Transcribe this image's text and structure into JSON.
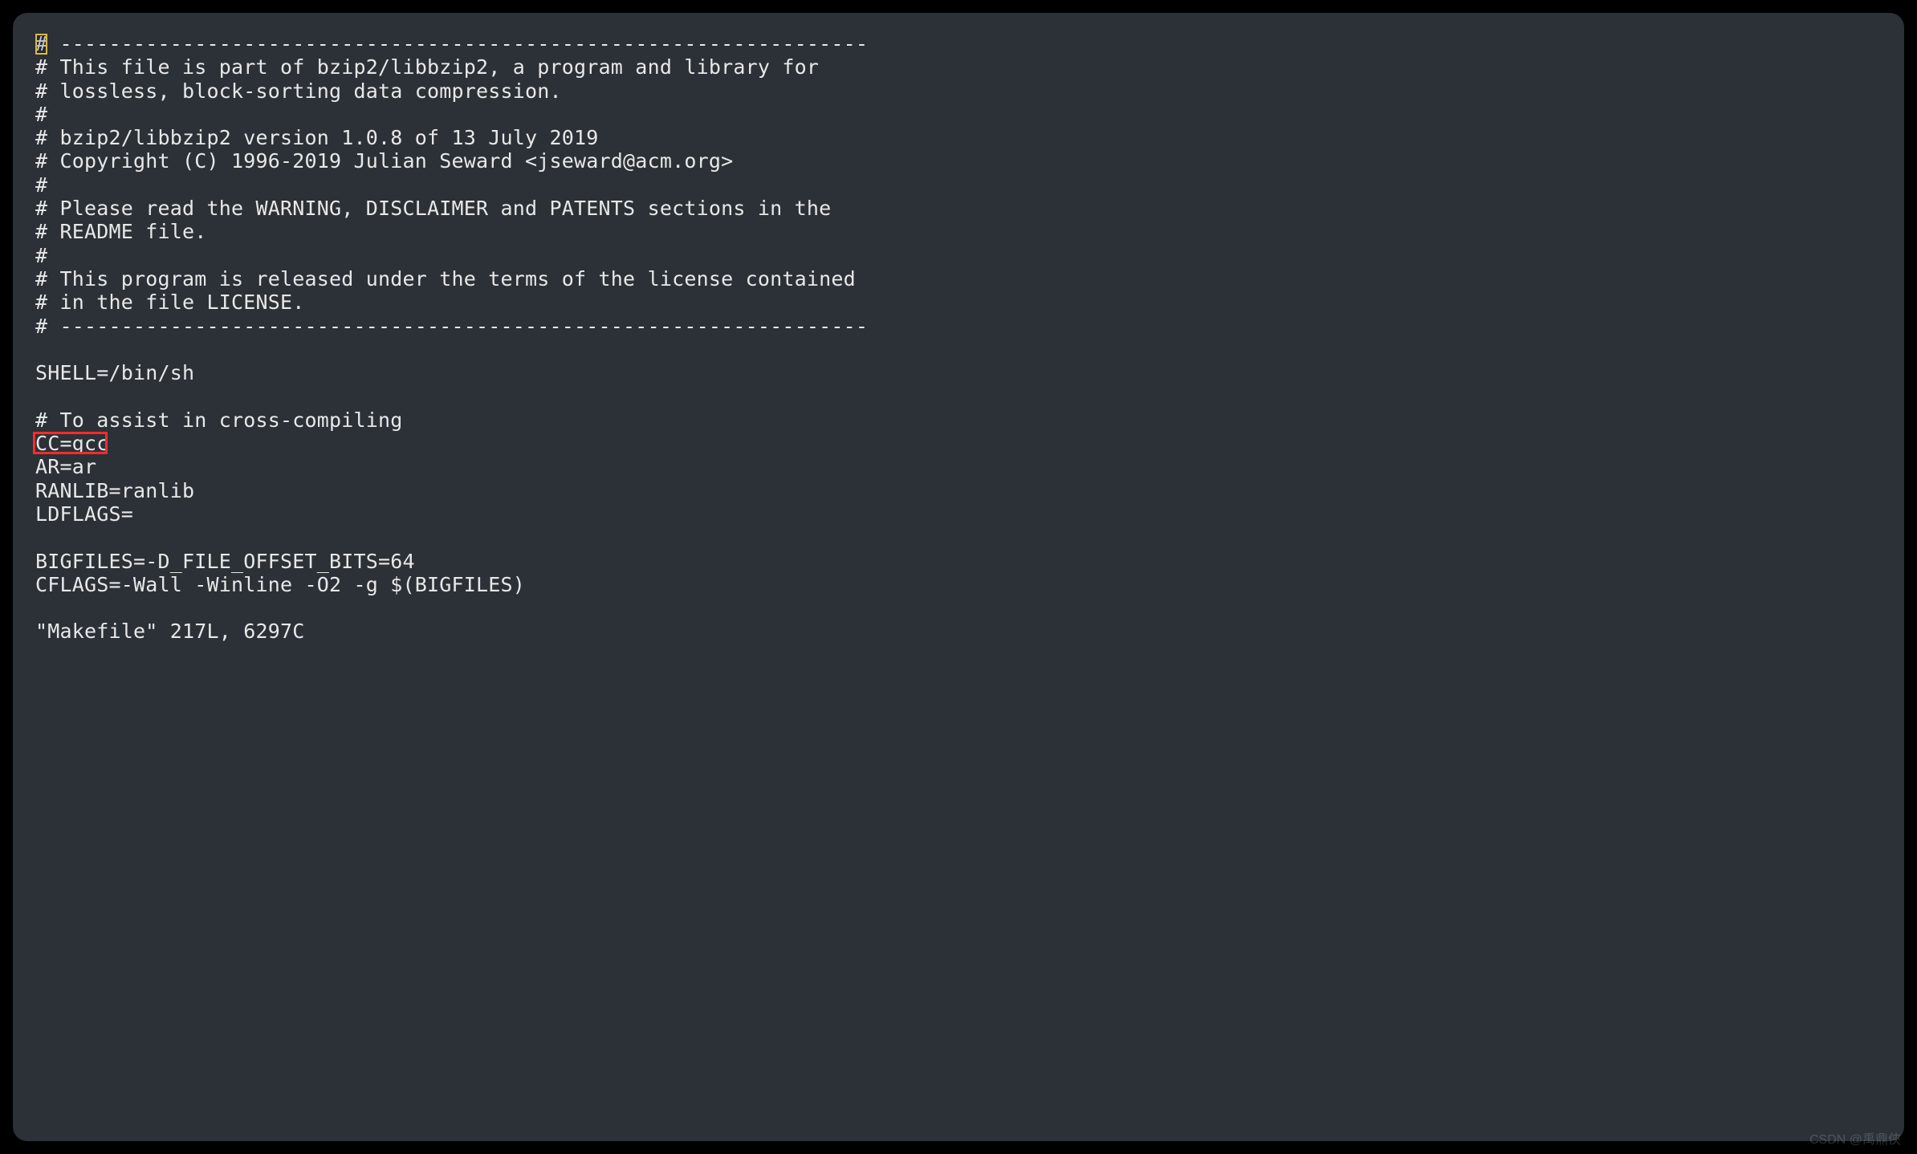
{
  "editor": {
    "cursor_char": "#",
    "lines": {
      "l01_rest": " ------------------------------------------------------------------",
      "l02": "# This file is part of bzip2/libbzip2, a program and library for",
      "l03": "# lossless, block-sorting data compression.",
      "l04": "#",
      "l05": "# bzip2/libbzip2 version 1.0.8 of 13 July 2019",
      "l06": "# Copyright (C) 1996-2019 Julian Seward <jseward@acm.org>",
      "l07": "#",
      "l08": "# Please read the WARNING, DISCLAIMER and PATENTS sections in the",
      "l09": "# README file.",
      "l10": "#",
      "l11": "# This program is released under the terms of the license contained",
      "l12": "# in the file LICENSE.",
      "l13": "# ------------------------------------------------------------------",
      "l14": "",
      "l15": "SHELL=/bin/sh",
      "l16": "",
      "l17": "# To assist in cross-compiling",
      "l18": "CC=gcc",
      "l19": "AR=ar",
      "l20": "RANLIB=ranlib",
      "l21": "LDFLAGS=",
      "l22": "",
      "l23": "BIGFILES=-D_FILE_OFFSET_BITS=64",
      "l24": "CFLAGS=-Wall -Winline -O2 -g $(BIGFILES)",
      "l25": "",
      "l26": "\"Makefile\" 217L, 6297C"
    }
  },
  "highlight": {
    "target_line": "CC=gcc"
  },
  "watermark": "CSDN @禹鼎侠"
}
